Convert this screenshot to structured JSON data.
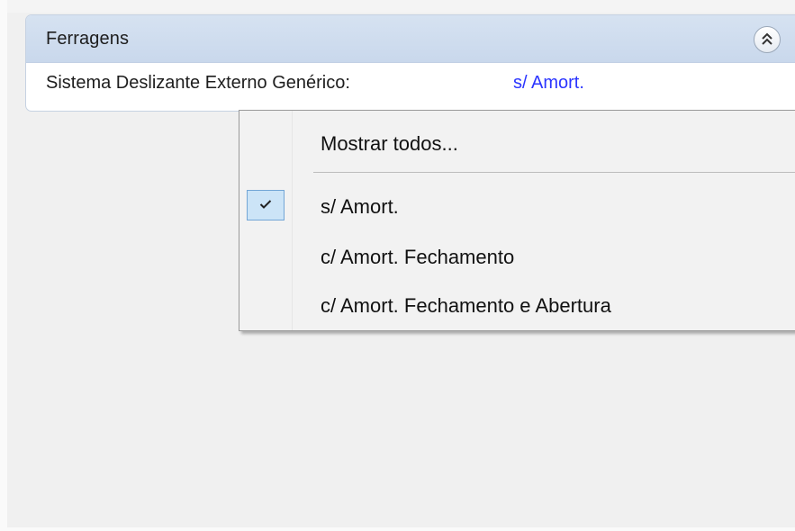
{
  "panel": {
    "title": "Ferragens",
    "collapse_icon": "chevron-double-up-icon"
  },
  "property": {
    "label": "Sistema Deslizante Externo Genérico:",
    "value": "s/ Amort."
  },
  "menu": {
    "show_all_label": "Mostrar todos...",
    "items": [
      {
        "label": "s/ Amort.",
        "checked": true
      },
      {
        "label": "c/ Amort. Fechamento",
        "checked": false
      },
      {
        "label": "c/ Amort. Fechamento e Abertura",
        "checked": false
      }
    ]
  },
  "colors": {
    "header_bg": "#d6e2f1",
    "link_value": "#2b35ff",
    "check_bg": "#cce4f7"
  }
}
